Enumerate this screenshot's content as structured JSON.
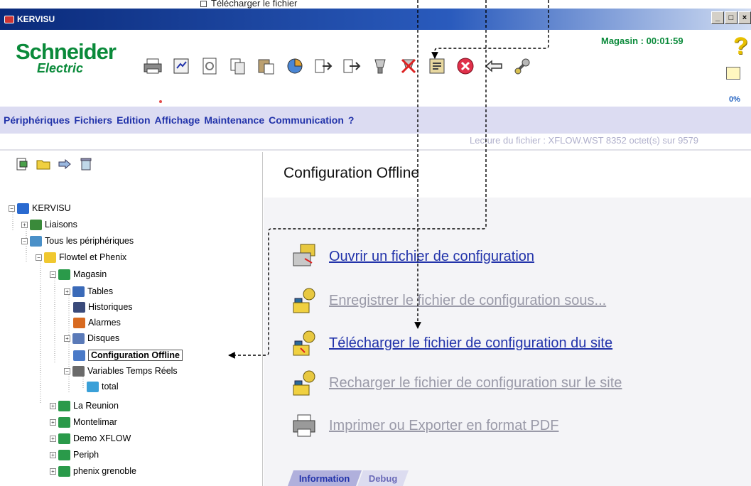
{
  "annotation_top": "Télécharger le fichier",
  "window": {
    "title": "KERVISU",
    "minimize_label": "_",
    "restore_label": "□",
    "close_label": "×"
  },
  "logo": {
    "line1": "Schneider",
    "line2": "Electric"
  },
  "toolbar": {
    "icons": [
      "print-icon",
      "report-icon",
      "refresh-icon",
      "copy-icon",
      "paste-icon",
      "pie-chart-icon",
      "export-icon",
      "import-icon",
      "download-icon",
      "disconnect-icon",
      "properties-icon",
      "stop-icon",
      "back-arrow-icon",
      "tools-icon"
    ]
  },
  "status": {
    "store_label": "Magasin :",
    "timer": "00:01:59",
    "progress_text": "0%",
    "progress": 0
  },
  "menu": [
    "Périphériques",
    "Fichiers",
    "Edition",
    "Affichage",
    "Maintenance",
    "Communication",
    "?"
  ],
  "file_info": "Lecture du fichier : XFLOW.WST 8352 octet(s) sur 9579",
  "tree": {
    "root": "KERVISU",
    "items": [
      {
        "label": "Liaisons"
      },
      {
        "label": "Tous les périphériques"
      },
      {
        "label": "Flowtel et Phenix"
      },
      {
        "label": "Magasin"
      },
      {
        "label": "Tables"
      },
      {
        "label": "Historiques"
      },
      {
        "label": "Alarmes"
      },
      {
        "label": "Disques"
      },
      {
        "label": "Configuration Offline"
      },
      {
        "label": "Variables Temps Réels"
      },
      {
        "label": "total"
      },
      {
        "label": "La Reunion"
      },
      {
        "label": "Montelimar"
      },
      {
        "label": "Demo XFLOW"
      },
      {
        "label": "Periph"
      },
      {
        "label": "phenix grenoble"
      }
    ]
  },
  "main": {
    "title": "Configuration Offline",
    "actions": [
      {
        "label": "Ouvrir un fichier de configuration",
        "enabled": true
      },
      {
        "label": "Enregistrer le fichier de configuration sous...",
        "enabled": false
      },
      {
        "label": "Télécharger le fichier de configuration du site",
        "enabled": true
      },
      {
        "label": "Recharger le fichier de configuration sur le site",
        "enabled": false
      },
      {
        "label": "Imprimer ou Exporter en format PDF",
        "enabled": false
      }
    ],
    "tabs": [
      {
        "label": "Information",
        "active": true
      },
      {
        "label": "Debug",
        "active": false
      }
    ]
  },
  "colors": {
    "accent": "#2233aa",
    "brand_green": "#0a8a3a",
    "disabled": "#9a9aa8",
    "menu_bg": "#dcdcf2"
  }
}
